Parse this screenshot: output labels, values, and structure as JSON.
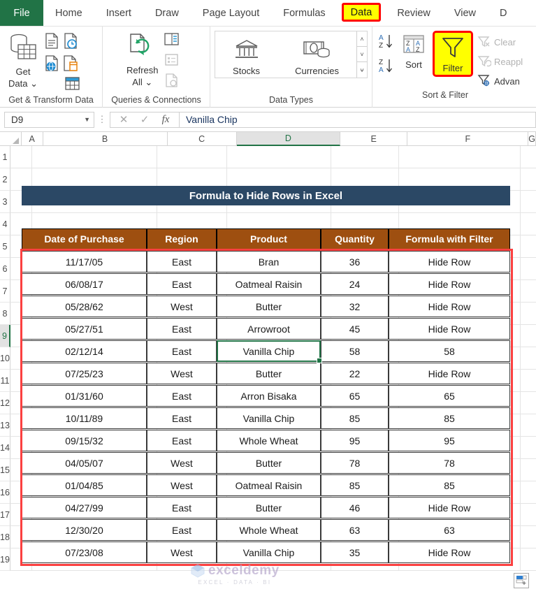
{
  "ribbon": {
    "tabs": [
      {
        "label": "File",
        "type": "file"
      },
      {
        "label": "Home",
        "type": "normal"
      },
      {
        "label": "Insert",
        "type": "normal"
      },
      {
        "label": "Draw",
        "type": "normal"
      },
      {
        "label": "Page Layout",
        "type": "normal"
      },
      {
        "label": "Formulas",
        "type": "normal"
      },
      {
        "label": "Data",
        "type": "highlighted"
      },
      {
        "label": "Review",
        "type": "normal"
      },
      {
        "label": "View",
        "type": "normal"
      },
      {
        "label": "D",
        "type": "clipped"
      }
    ],
    "groups": {
      "get_transform": {
        "label": "Get & Transform Data",
        "main_button": "Get\nData",
        "main_line1": "Get",
        "main_line2": "Data",
        "icons": [
          "from-text-csv-icon",
          "recent-sources-icon",
          "from-web-icon",
          "from-table-range-icon",
          "existing-connections-icon"
        ]
      },
      "queries": {
        "label": "Queries & Connections",
        "main_line1": "Refresh",
        "main_line2": "All",
        "icons": [
          "queries-connections-icon",
          "properties-icon",
          "edit-links-icon"
        ]
      },
      "data_types": {
        "label": "Data Types",
        "items": [
          {
            "label": "Stocks",
            "icon": "bank-stocks-icon"
          },
          {
            "label": "Currencies",
            "icon": "currency-money-icon"
          }
        ],
        "spinner": [
          "˄",
          "˅",
          "⩝"
        ]
      },
      "sort_filter": {
        "label": "Sort & Filter",
        "sort_az_label": "A\nZ",
        "sort_za_label": "Z\nA",
        "sort_label": "Sort",
        "filter_label": "Filter",
        "clear_label": "Clear",
        "reapply_label": "Reappl",
        "advanced_label": "Advan"
      }
    }
  },
  "formula_bar": {
    "name_box": "D9",
    "cancel_icon": "✕",
    "confirm_icon": "✓",
    "fx_icon": "fx",
    "value": "Vanilla Chip"
  },
  "grid": {
    "columns": [
      "A",
      "B",
      "C",
      "D",
      "E",
      "F",
      "G"
    ],
    "selected_column": "D",
    "rows": [
      "1",
      "2",
      "3",
      "4",
      "5",
      "6",
      "7",
      "8",
      "9",
      "10",
      "11",
      "12",
      "13",
      "14",
      "15",
      "16",
      "17",
      "18",
      "19"
    ],
    "selected_row": "9"
  },
  "sheet": {
    "title": "Formula to Hide Rows in Excel",
    "headers": [
      "Date of Purchase",
      "Region",
      "Product",
      "Quantity",
      "Formula with Filter"
    ],
    "rows": [
      {
        "date": "11/17/05",
        "region": "East",
        "product": "Bran",
        "quantity": "36",
        "formula": "Hide Row"
      },
      {
        "date": "06/08/17",
        "region": "East",
        "product": "Oatmeal Raisin",
        "quantity": "24",
        "formula": "Hide Row"
      },
      {
        "date": "05/28/62",
        "region": "West",
        "product": "Butter",
        "quantity": "32",
        "formula": "Hide Row"
      },
      {
        "date": "05/27/51",
        "region": "East",
        "product": "Arrowroot",
        "quantity": "45",
        "formula": "Hide Row"
      },
      {
        "date": "02/12/14",
        "region": "East",
        "product": "Vanilla Chip",
        "quantity": "58",
        "formula": "58"
      },
      {
        "date": "07/25/23",
        "region": "West",
        "product": "Butter",
        "quantity": "22",
        "formula": "Hide Row"
      },
      {
        "date": "01/31/60",
        "region": "East",
        "product": "Arron Bisaka",
        "quantity": "65",
        "formula": "65"
      },
      {
        "date": "10/11/89",
        "region": "East",
        "product": "Vanilla Chip",
        "quantity": "85",
        "formula": "85"
      },
      {
        "date": "09/15/32",
        "region": "East",
        "product": "Whole Wheat",
        "quantity": "95",
        "formula": "95"
      },
      {
        "date": "04/05/07",
        "region": "West",
        "product": "Butter",
        "quantity": "78",
        "formula": "78"
      },
      {
        "date": "01/04/85",
        "region": "West",
        "product": "Oatmeal Raisin",
        "quantity": "85",
        "formula": "85"
      },
      {
        "date": "04/27/99",
        "region": "East",
        "product": "Butter",
        "quantity": "46",
        "formula": "Hide Row"
      },
      {
        "date": "12/30/20",
        "region": "East",
        "product": "Whole Wheat",
        "quantity": "63",
        "formula": "63"
      },
      {
        "date": "07/23/08",
        "region": "West",
        "product": "Vanilla Chip",
        "quantity": "35",
        "formula": "Hide Row"
      }
    ]
  },
  "watermark": {
    "name": "exceldemy",
    "tagline": "EXCEL · DATA · BI"
  },
  "colors": {
    "file_tab_green": "#217346",
    "highlight_yellow": "#ffff00",
    "highlight_red": "#ff0000",
    "title_navy": "#2b4865",
    "header_brown": "#9e4f10",
    "selection_red": "#fb4040"
  }
}
